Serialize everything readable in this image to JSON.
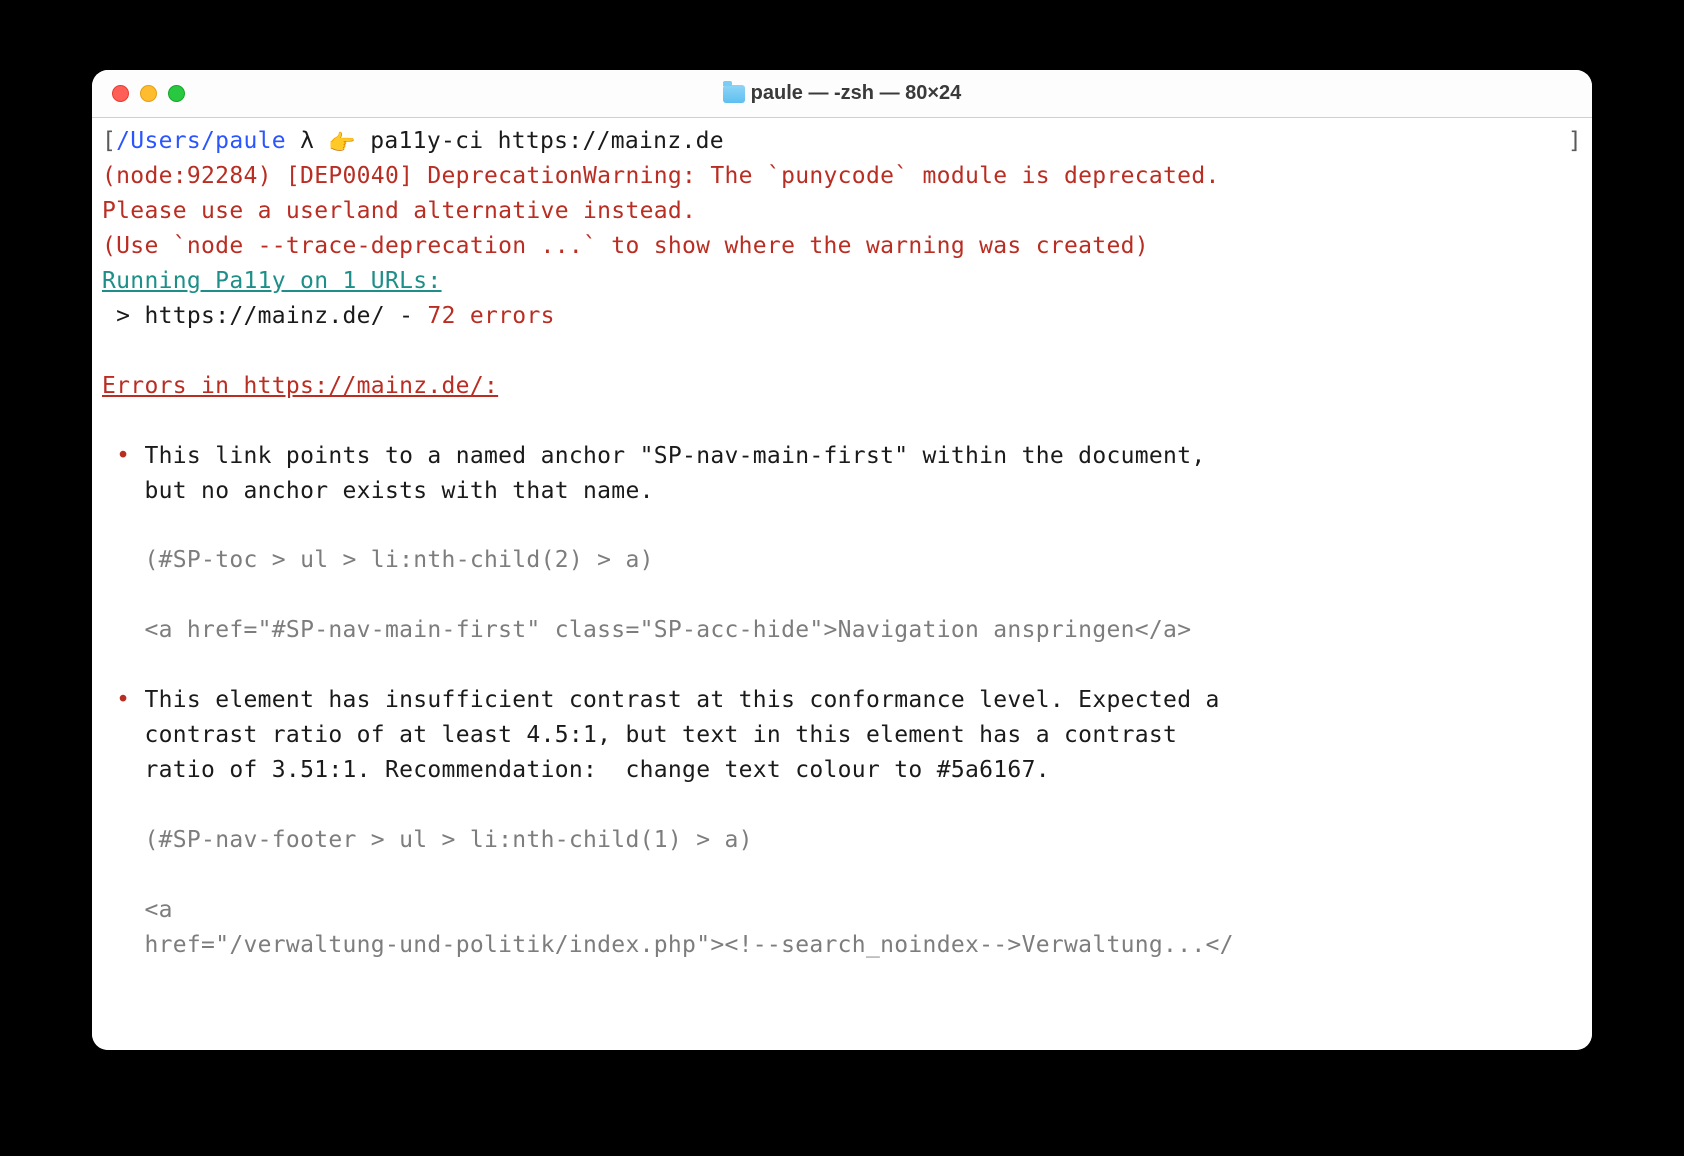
{
  "window": {
    "title": "paule — -zsh — 80×24"
  },
  "prompt": {
    "open_bracket": "[",
    "path": "/Users/paule",
    "lambda": " λ ",
    "pointer": "👉",
    "command": " pa11y-ci https://mainz.de",
    "close_bracket": "]"
  },
  "deprecation": {
    "line1": "(node:92284) [DEP0040] DeprecationWarning: The `punycode` module is deprecated.",
    "line2": "Please use a userland alternative instead.",
    "line3": "(Use `node --trace-deprecation ...` to show where the warning was created)"
  },
  "running": "Running Pa11y on 1 URLs:",
  "result": {
    "prefix": " > ",
    "url": "https://mainz.de/",
    "dash": " - ",
    "errors": "72 errors"
  },
  "errors_header": "Errors in https://mainz.de/:",
  "errors": [
    {
      "bullet": " • ",
      "text": "This link points to a named anchor \"SP-nav-main-first\" within the document,\n   but no anchor exists with that name.",
      "selector": "   (#SP-toc > ul > li:nth-child(2) > a)",
      "snippet": "   <a href=\"#SP-nav-main-first\" class=\"SP-acc-hide\">Navigation anspringen</a>"
    },
    {
      "bullet": " • ",
      "text": "This element has insufficient contrast at this conformance level. Expected a\n   contrast ratio of at least 4.5:1, but text in this element has a contrast\n   ratio of 3.51:1. Recommendation:  change text colour to #5a6167.",
      "selector": "   (#SP-nav-footer > ul > li:nth-child(1) > a)",
      "snippet": "   <a\n   href=\"/verwaltung-und-politik/index.php\"><!--search_noindex-->Verwaltung...</"
    }
  ]
}
